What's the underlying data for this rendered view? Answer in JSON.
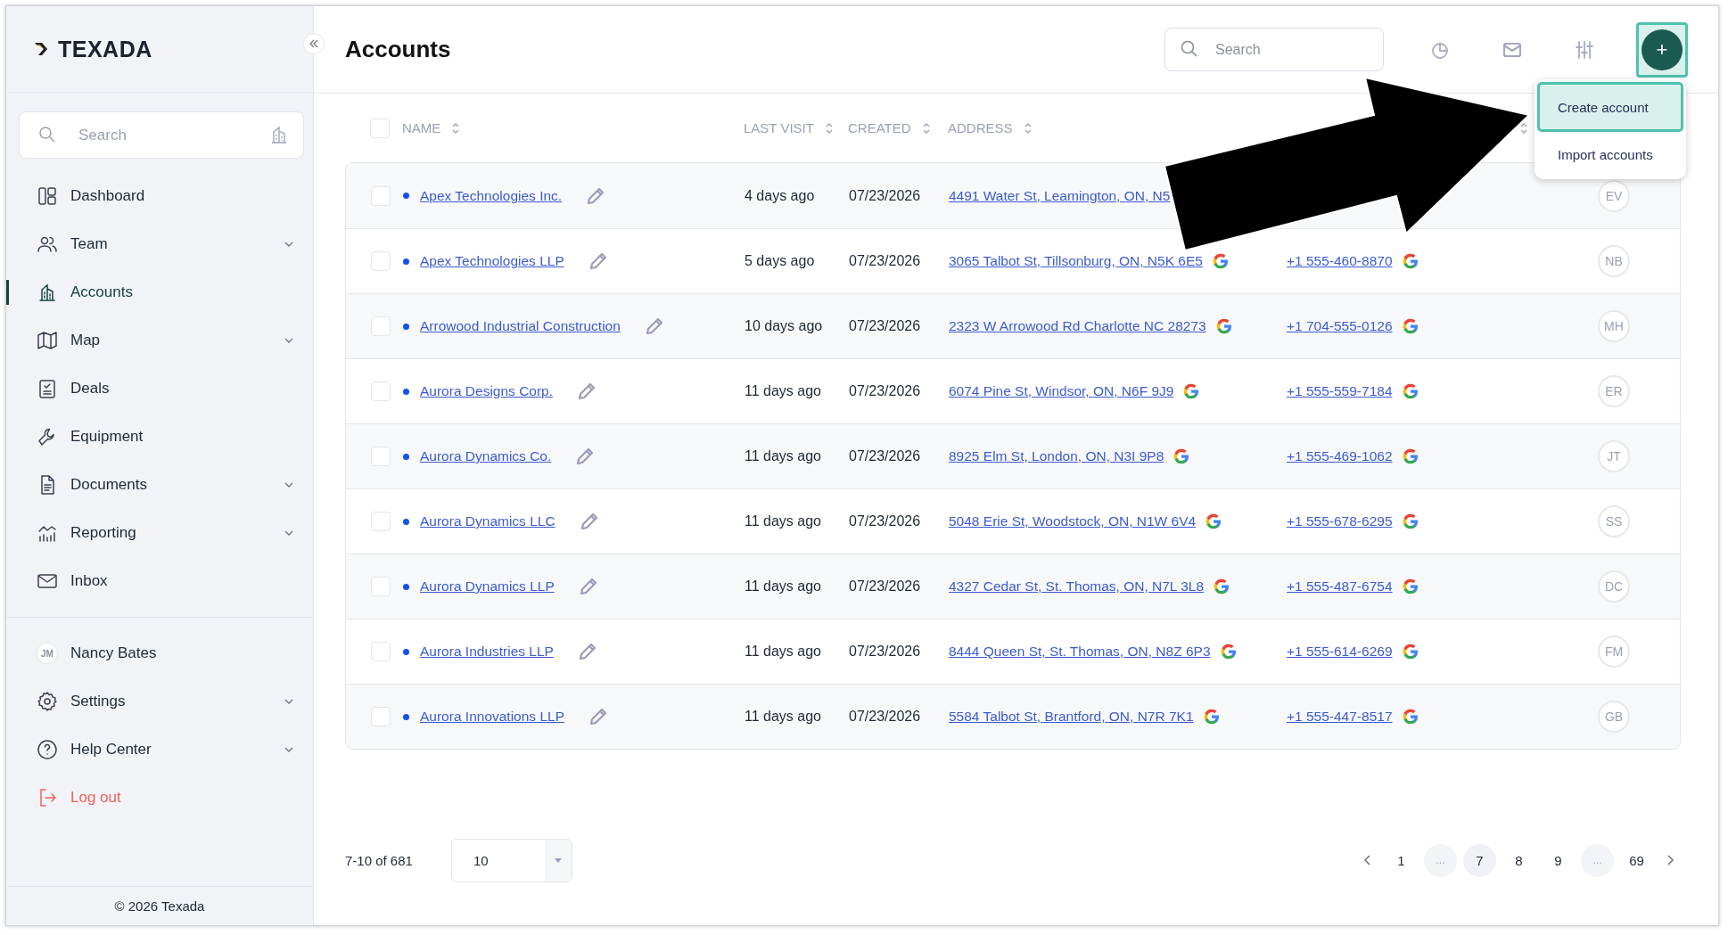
{
  "sidebar": {
    "logo": "TEXADA",
    "search": {
      "placeholder": "Search"
    },
    "items": [
      {
        "label": "Dashboard",
        "selected": false,
        "has_submenu": false
      },
      {
        "label": "Team",
        "selected": false,
        "has_submenu": true
      },
      {
        "label": "Accounts",
        "selected": true,
        "has_submenu": false
      },
      {
        "label": "Map",
        "selected": false,
        "has_submenu": true
      },
      {
        "label": "Deals",
        "selected": false,
        "has_submenu": false
      },
      {
        "label": "Equipment",
        "selected": false,
        "has_submenu": false
      },
      {
        "label": "Documents",
        "selected": false,
        "has_submenu": true
      },
      {
        "label": "Reporting",
        "selected": false,
        "has_submenu": true
      },
      {
        "label": "Inbox",
        "selected": false,
        "has_submenu": false
      }
    ],
    "bottom_items": [
      {
        "kind": "user",
        "label": "Nancy Bates",
        "avatar": "JM",
        "has_submenu": false
      },
      {
        "kind": "nav",
        "label": "Settings",
        "has_submenu": true
      },
      {
        "kind": "nav",
        "label": "Help Center",
        "has_submenu": true
      },
      {
        "kind": "logout",
        "label": "Log out",
        "has_submenu": false
      }
    ],
    "footer": "© 2026 Texada"
  },
  "header": {
    "title": "Accounts",
    "search": {
      "placeholder": "Search"
    },
    "add_button": "+"
  },
  "menu": [
    {
      "label": "Create account",
      "selected": true
    },
    {
      "label": "Import accounts",
      "selected": false
    }
  ],
  "table": {
    "select_all_checked": false,
    "columns": [
      "NAME",
      "LAST VISIT",
      "CREATED",
      "ADDRESS"
    ],
    "rows": [
      {
        "checked": false,
        "name": "Apex Technologies Inc.",
        "last_visit": "4 days ago",
        "created": "07/23/2026",
        "address": "4491 Water St, Leamington, ON, N5",
        "owner": "EV"
      },
      {
        "checked": false,
        "name": "Apex Technologies LLP",
        "last_visit": "5 days ago",
        "created": "07/23/2026",
        "address": "3065 Talbot St, Tillsonburg, ON, N5K 6E5",
        "phone": "+1 555-460-8870",
        "owner": "NB"
      },
      {
        "checked": false,
        "name": "Arrowood Industrial Construction",
        "last_visit": "10 days ago",
        "created": "07/23/2026",
        "address": "2323 W Arrowood Rd Charlotte NC 28273",
        "phone": "+1 704-555-0126",
        "owner": "MH"
      },
      {
        "checked": false,
        "name": "Aurora Designs Corp.",
        "last_visit": "11 days ago",
        "created": "07/23/2026",
        "address": "6074 Pine St, Windsor, ON, N6F 9J9",
        "phone": "+1 555-559-7184",
        "owner": "ER"
      },
      {
        "checked": false,
        "name": "Aurora Dynamics Co.",
        "last_visit": "11 days ago",
        "created": "07/23/2026",
        "address": "8925 Elm St, London, ON, N3I 9P8",
        "phone": "+1 555-469-1062",
        "owner": "JT"
      },
      {
        "checked": false,
        "name": "Aurora Dynamics LLC",
        "last_visit": "11 days ago",
        "created": "07/23/2026",
        "address": "5048 Erie St, Woodstock, ON, N1W 6V4",
        "phone": "+1 555-678-6295",
        "owner": "SS"
      },
      {
        "checked": false,
        "name": "Aurora Dynamics LLP",
        "last_visit": "11 days ago",
        "created": "07/23/2026",
        "address": "4327 Cedar St, St. Thomas, ON, N7L 3L8",
        "phone": "+1 555-487-6754",
        "owner": "DC"
      },
      {
        "checked": false,
        "name": "Aurora Industries LLP",
        "last_visit": "11 days ago",
        "created": "07/23/2026",
        "address": "8444 Queen St, St. Thomas, ON, N8Z 6P3",
        "phone": "+1 555-614-6269",
        "owner": "FM"
      },
      {
        "checked": false,
        "name": "Aurora Innovations LLP",
        "last_visit": "11 days ago",
        "created": "07/23/2026",
        "address": "5584 Talbot St, Brantford, ON, N7R 7K1",
        "phone": "+1 555-447-8517",
        "owner": "GB"
      }
    ]
  },
  "pagination": {
    "range": "7-10 of 681",
    "page_size": "10",
    "pages": [
      {
        "label": "1",
        "kind": "page",
        "selected": false
      },
      {
        "label": "...",
        "kind": "gap"
      },
      {
        "label": "7",
        "kind": "page",
        "selected": true
      },
      {
        "label": "8",
        "kind": "page",
        "selected": false
      },
      {
        "label": "9",
        "kind": "page",
        "selected": false
      },
      {
        "label": "...",
        "kind": "gap"
      },
      {
        "label": "69",
        "kind": "page",
        "selected": false
      }
    ]
  }
}
